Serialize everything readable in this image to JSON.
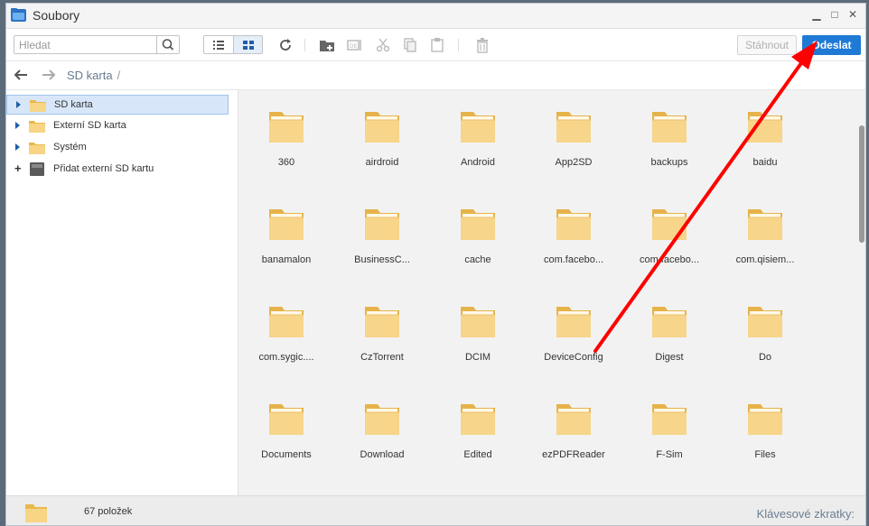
{
  "window": {
    "title": "Soubory",
    "controls": {
      "minimize": "▁",
      "maximize": "□",
      "close": "✕"
    }
  },
  "toolbar": {
    "search_placeholder": "Hledat",
    "download_label": "Stáhnout",
    "send_label": "Odeslat",
    "icons": [
      "list-view-icon",
      "grid-view-icon",
      "refresh-icon",
      "new-folder-icon",
      "rename-icon",
      "cut-icon",
      "copy-icon",
      "paste-icon",
      "trash-icon"
    ]
  },
  "navbar": {
    "breadcrumb": "SD karta",
    "separator": "/"
  },
  "sidebar": {
    "items": [
      {
        "label": "SD karta",
        "selected": true
      },
      {
        "label": "Externí SD karta",
        "selected": false
      },
      {
        "label": "Systém",
        "selected": false
      },
      {
        "label": "Přidat externí SD kartu",
        "selected": false
      }
    ]
  },
  "folders": [
    "360",
    "airdroid",
    "Android",
    "App2SD",
    "backups",
    "baidu",
    "banamalon",
    "BusinessC...",
    "cache",
    "com.facebo...",
    "com.facebo...",
    "com.qisiem...",
    "com.sygic....",
    "CzTorrent",
    "DCIM",
    "DeviceConfig",
    "Digest",
    "Do",
    "Documents",
    "Download",
    "Edited",
    "ezPDFReader",
    "F-Sim",
    "Files"
  ],
  "status": {
    "count": "67 položek",
    "shortcuts": "Klávesové zkratky:"
  },
  "colors": {
    "accent": "#1f7ad6",
    "annotation": "#ff0000",
    "folder": "#f5cf7a"
  }
}
